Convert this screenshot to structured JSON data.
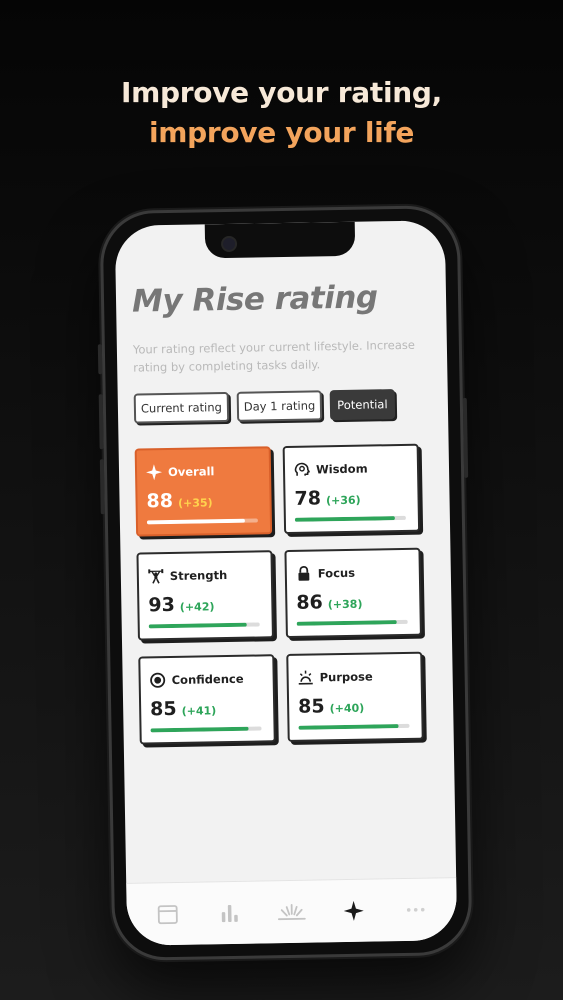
{
  "headline": {
    "line1": "Improve your rating,",
    "line2": "improve your life"
  },
  "screen": {
    "title": "My Rise rating",
    "subtitle": "Your rating reflect your current lifestyle. Increase rating by completing tasks daily.",
    "tabs": [
      {
        "label": "Current rating",
        "active": false
      },
      {
        "label": "Day 1 rating",
        "active": false
      },
      {
        "label": "Potential",
        "active": true
      }
    ],
    "cards": [
      {
        "label": "Overall",
        "icon": "sparkle-icon",
        "score": "88",
        "delta": "(+35)",
        "progress": 0.88,
        "highlight": true
      },
      {
        "label": "Wisdom",
        "icon": "head-brain-icon",
        "score": "78",
        "delta": "(+36)",
        "progress": 0.9
      },
      {
        "label": "Strength",
        "icon": "weightlifter-icon",
        "score": "93",
        "delta": "(+42)",
        "progress": 0.88
      },
      {
        "label": "Focus",
        "icon": "lock-icon",
        "score": "86",
        "delta": "(+38)",
        "progress": 0.9
      },
      {
        "label": "Confidence",
        "icon": "target-icon",
        "score": "85",
        "delta": "(+41)",
        "progress": 0.88
      },
      {
        "label": "Purpose",
        "icon": "sunrise-icon",
        "score": "85",
        "delta": "(+40)",
        "progress": 0.9
      }
    ],
    "tabbar": [
      {
        "icon": "calendar-icon",
        "active": false
      },
      {
        "icon": "bar-chart-icon",
        "active": false
      },
      {
        "icon": "rise-logo-icon",
        "active": false
      },
      {
        "icon": "sparkle-icon",
        "active": true
      },
      {
        "icon": "more-icon",
        "active": false
      }
    ]
  },
  "colors": {
    "accent_orange": "#ef7a3f",
    "progress_green": "#2ea55a",
    "headline_cream": "#f7e9d8",
    "headline_orange": "#f3a45c"
  }
}
